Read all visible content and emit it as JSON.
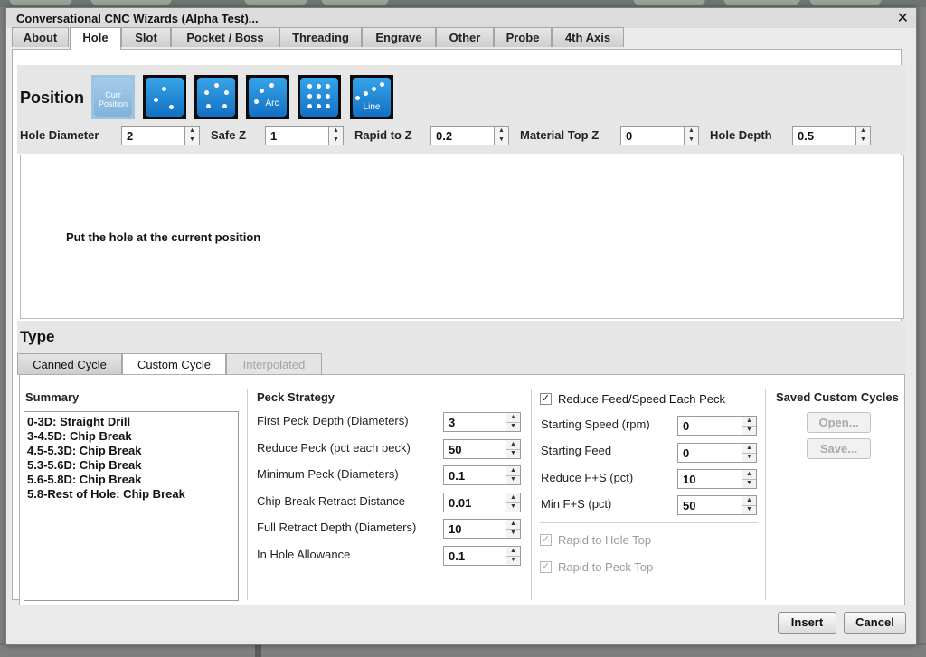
{
  "dialog": {
    "title": "Conversational CNC Wizards (Alpha Test)...",
    "close_glyph": "✕"
  },
  "tabs": [
    {
      "label": "About"
    },
    {
      "label": "Hole"
    },
    {
      "label": "Slot"
    },
    {
      "label": "Pocket / Boss"
    },
    {
      "label": "Threading"
    },
    {
      "label": "Engrave"
    },
    {
      "label": "Other"
    },
    {
      "label": "Probe"
    },
    {
      "label": "4th Axis"
    }
  ],
  "active_tab": "Hole",
  "position": {
    "heading": "Position",
    "buttons": [
      {
        "name": "curr-position",
        "label": "Curr\nPosition",
        "selected": true
      },
      {
        "name": "pattern-a",
        "label": ""
      },
      {
        "name": "circle-pattern",
        "label": ""
      },
      {
        "name": "arc-pattern",
        "label": "Arc"
      },
      {
        "name": "grid-pattern",
        "label": ""
      },
      {
        "name": "line-pattern",
        "label": "Line"
      }
    ]
  },
  "params": {
    "hole_diameter": {
      "label": "Hole Diameter",
      "value": "2"
    },
    "safe_z": {
      "label": "Safe Z",
      "value": "1"
    },
    "rapid_to_z": {
      "label": "Rapid to Z",
      "value": "0.2"
    },
    "material_top_z": {
      "label": "Material Top Z",
      "value": "0"
    },
    "hole_depth": {
      "label": "Hole Depth",
      "value": "0.5"
    }
  },
  "description": "Put the hole at the current position",
  "type": {
    "heading": "Type",
    "subtabs": [
      {
        "label": "Canned Cycle",
        "state": "normal"
      },
      {
        "label": "Custom Cycle",
        "state": "active"
      },
      {
        "label": "Interpolated",
        "state": "disabled"
      }
    ]
  },
  "summary": {
    "heading": "Summary",
    "items": [
      "0-3D: Straight Drill",
      "3-4.5D: Chip Break",
      "4.5-5.3D: Chip Break",
      "5.3-5.6D: Chip Break",
      "5.6-5.8D: Chip Break",
      "5.8-Rest of Hole: Chip Break"
    ]
  },
  "peck": {
    "heading": "Peck Strategy",
    "fields": [
      {
        "label": "First Peck Depth (Diameters)",
        "value": "3"
      },
      {
        "label": "Reduce Peck (pct each peck)",
        "value": "50"
      },
      {
        "label": "Minimum Peck (Diameters)",
        "value": "0.1"
      },
      {
        "label": "Chip Break Retract Distance",
        "value": "0.01"
      },
      {
        "label": "Full Retract Depth (Diameters)",
        "value": "10"
      },
      {
        "label": "In Hole Allowance",
        "value": "0.1"
      }
    ]
  },
  "feed": {
    "reduce_label": "Reduce Feed/Speed Each Peck",
    "reduce_checked": true,
    "fields": [
      {
        "label": "Starting Speed (rpm)",
        "value": "0"
      },
      {
        "label": "Starting Feed",
        "value": "0"
      },
      {
        "label": "Reduce F+S (pct)",
        "value": "10"
      },
      {
        "label": "Min F+S (pct)",
        "value": "50"
      }
    ],
    "rapid_hole_top": "Rapid to Hole Top",
    "rapid_peck_top": "Rapid to Peck Top",
    "check_glyph": "✓"
  },
  "saved": {
    "heading": "Saved Custom Cycles",
    "open": "Open...",
    "save": "Save..."
  },
  "footer": {
    "insert": "Insert",
    "cancel": "Cancel"
  },
  "arrows": {
    "up": "▲",
    "down": "▼"
  }
}
